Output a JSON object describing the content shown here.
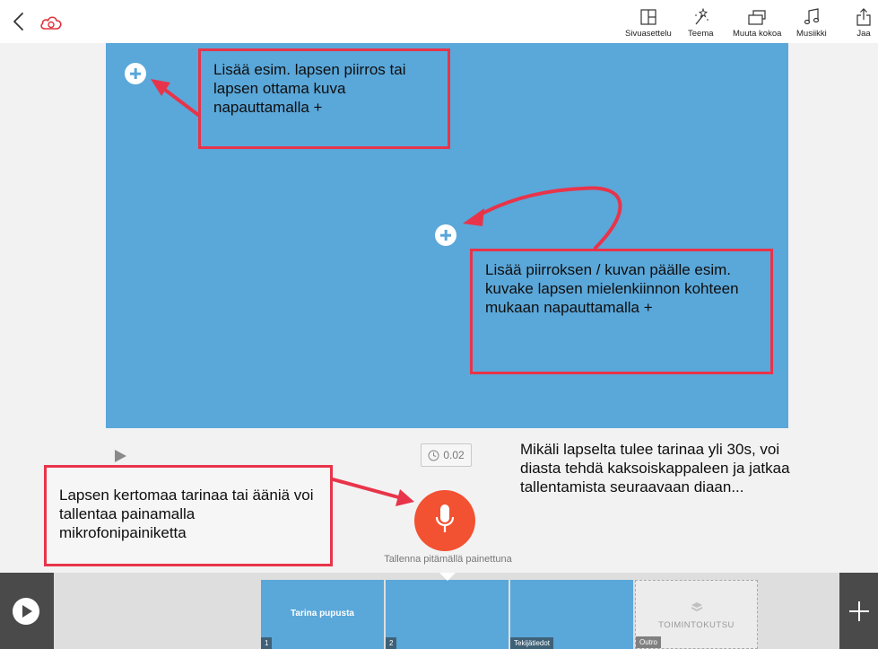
{
  "toolbar": {
    "items": [
      {
        "label": "Sivuasettelu",
        "icon": "layout-icon"
      },
      {
        "label": "Teema",
        "icon": "magic-wand-icon"
      },
      {
        "label": "Muuta kokoa",
        "icon": "resize-icon"
      },
      {
        "label": "Musiikki",
        "icon": "music-note-icon"
      },
      {
        "label": "Jaa",
        "icon": "share-icon"
      }
    ]
  },
  "annotations": {
    "top_left": "Lisää esim. lapsen piirros tai lapsen ottama kuva napauttamalla +",
    "middle_right": "Lisää piirroksen / kuvan päälle esim. kuvake lapsen mielenkiinnon kohteen mukaan napauttamalla +",
    "bottom_left": "Lapsen kertomaa tarinaa tai ääniä voi tallentaa painamalla mikrofonipainiketta",
    "bottom_right": "Mikäli lapselta tulee tarinaa yli 30s, voi diasta tehdä kaksoiskappaleen ja jatkaa tallentamista seuraavaan diaan..."
  },
  "controls": {
    "timer": "0.02",
    "record_hint": "Tallenna pitämällä painettuna"
  },
  "slides": [
    {
      "title": "Tarina pupusta",
      "badge": "1"
    },
    {
      "title": "",
      "badge": "2"
    },
    {
      "title": "",
      "badge": "Tekijätiedot"
    },
    {
      "title": "TOIMINTOKUTSU",
      "badge": "Outro"
    }
  ],
  "colors": {
    "slide_blue": "#5aa7d9",
    "record_red": "#f25132",
    "callout_border": "#e8344a",
    "accent_cloud": "#e0323c"
  }
}
